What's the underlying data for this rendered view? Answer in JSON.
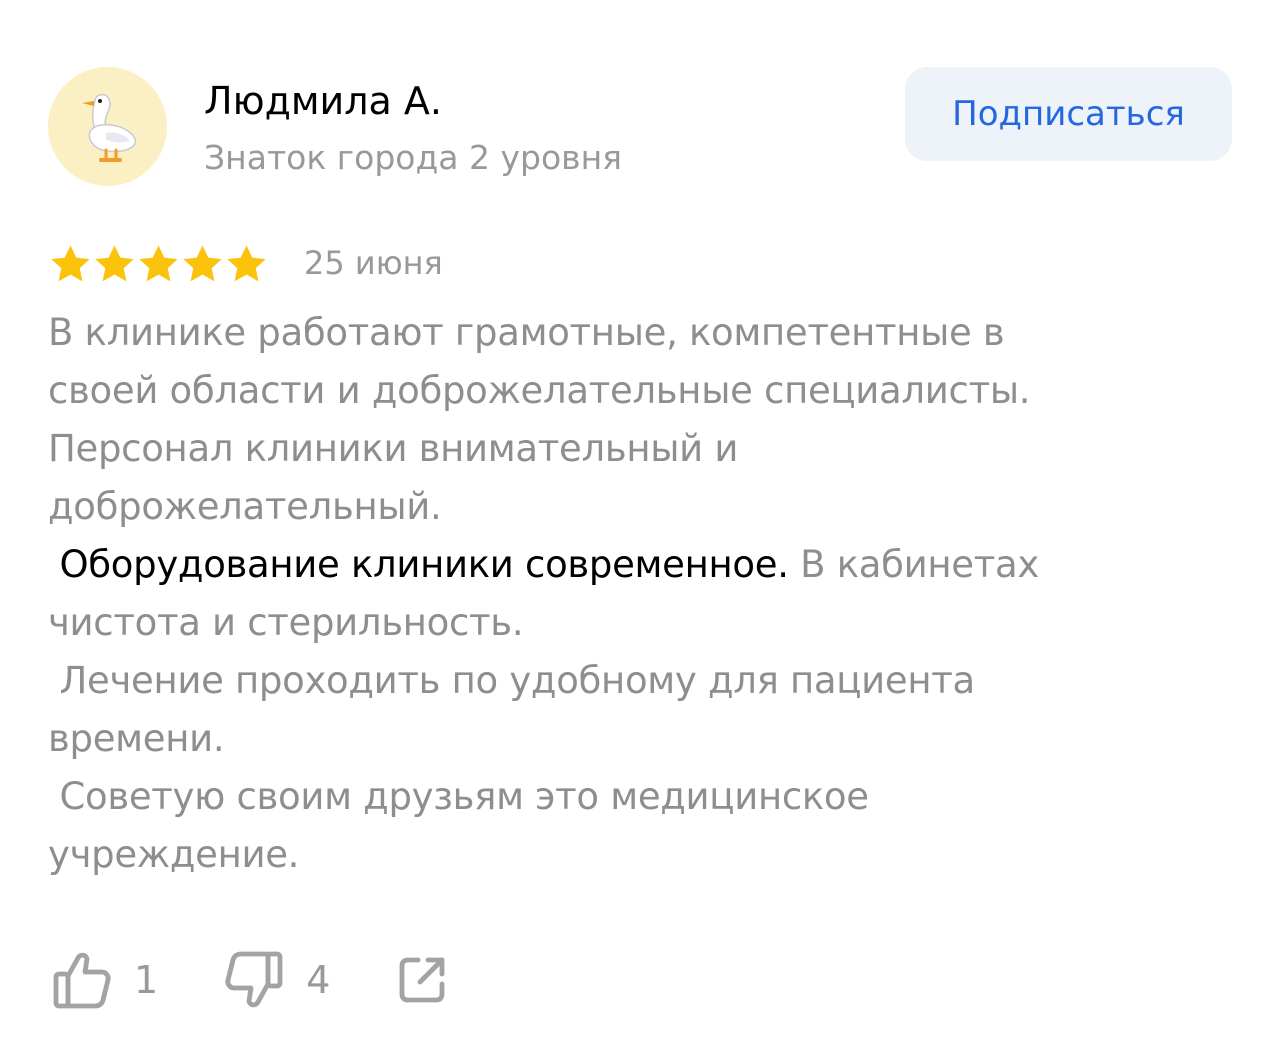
{
  "author": {
    "name": "Людмила А.",
    "level": "Знаток города 2 уровня",
    "avatar_icon": "goose-icon"
  },
  "subscribe_label": "Подписаться",
  "colors": {
    "accent": "#2467e0",
    "star": "#fcc30d",
    "muted_text": "#999999",
    "button_bg": "#eef3fa",
    "avatar_bg": "#fbf0c4"
  },
  "review": {
    "rating": 5,
    "rating_max": 5,
    "date": "25 июня",
    "lines": [
      "В клинике работают грамотные, компетентные в",
      "своей области и доброжелательные специалисты.",
      "Персонал клиники внимательный и",
      "доброжелательный."
    ],
    "line5_strong": " Оборудование клиники современное.",
    "line5_rest": " В кабинетах",
    "lines_after": [
      "чистота и стерильность.",
      " Лечение проходить по удобному для пациента",
      "времени.",
      " Советую своим друзьям это медицинское",
      "учреждение."
    ]
  },
  "actions": {
    "likes": "1",
    "dislikes": "4",
    "like_icon": "thumbs-up-icon",
    "dislike_icon": "thumbs-down-icon",
    "share_icon": "share-icon"
  }
}
